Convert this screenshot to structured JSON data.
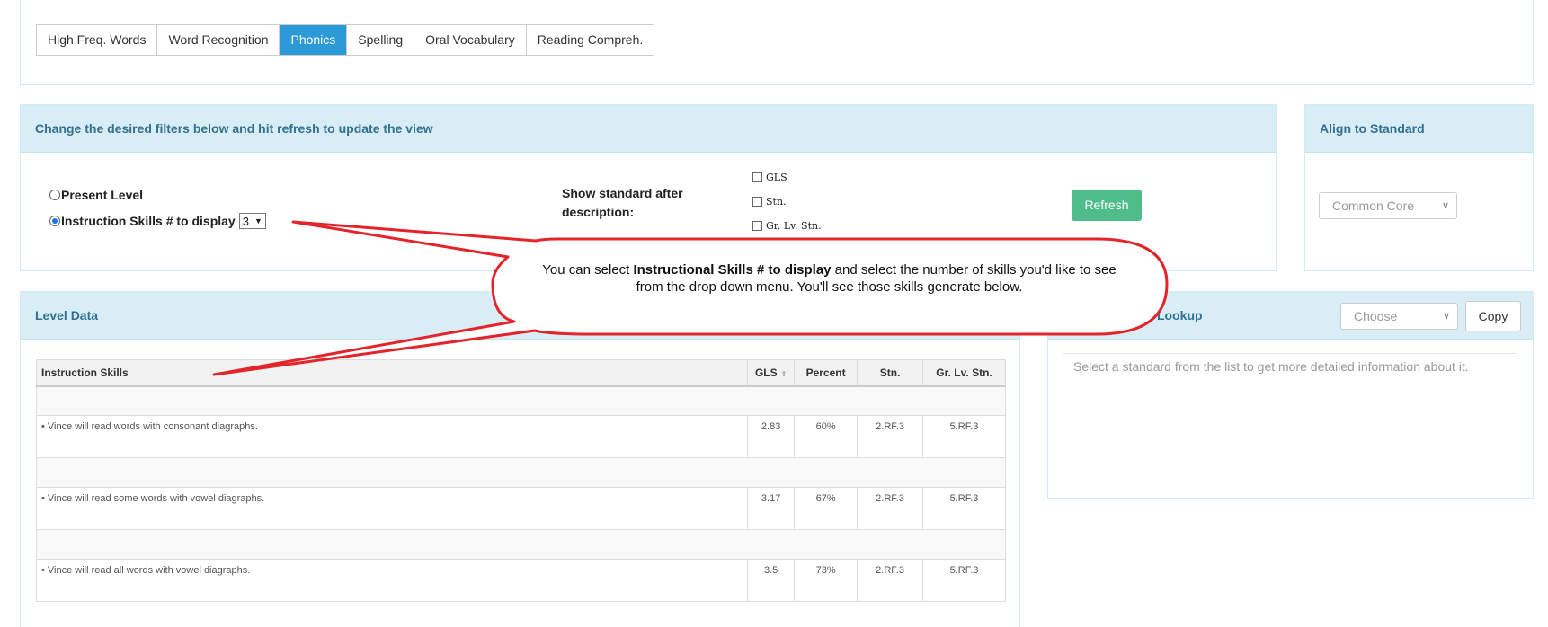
{
  "tabs": [
    {
      "label": "High Freq. Words",
      "active": false
    },
    {
      "label": "Word Recognition",
      "active": false
    },
    {
      "label": "Phonics",
      "active": true
    },
    {
      "label": "Spelling",
      "active": false
    },
    {
      "label": "Oral Vocabulary",
      "active": false
    },
    {
      "label": "Reading Compreh.",
      "active": false
    }
  ],
  "filters": {
    "heading": "Change the desired filters below and hit refresh to update the view",
    "present_level_label": "Present Level",
    "instruction_skills_label": "Instruction Skills # to display",
    "instruction_skills_value": "3",
    "show_standard_label": "Show standard after description:",
    "checkbox_gls": "GLS",
    "checkbox_stn": "Stn.",
    "checkbox_gr_lv_stn": "Gr. Lv. Stn.",
    "refresh_label": "Refresh"
  },
  "align": {
    "heading": "Align to Standard",
    "selected": "Common Core"
  },
  "level_data": {
    "heading": "Level Data",
    "columns": [
      "Instruction Skills",
      "GLS",
      "Percent",
      "Stn.",
      "Gr. Lv. Stn."
    ],
    "rows": [
      {
        "skill": "• Vince will read words with consonant diagraphs.",
        "gls": "2.83",
        "percent": "60%",
        "stn": "2.RF.3",
        "gr_lv_stn": "5.RF.3"
      },
      {
        "skill": "• Vince will read some words with vowel diagraphs.",
        "gls": "3.17",
        "percent": "67%",
        "stn": "2.RF.3",
        "gr_lv_stn": "5.RF.3"
      },
      {
        "skill": "• Vince will read all words with vowel diagraphs.",
        "gls": "3.5",
        "percent": "73%",
        "stn": "2.RF.3",
        "gr_lv_stn": "5.RF.3"
      }
    ]
  },
  "lookup": {
    "heading": "Lookup",
    "choose_placeholder": "Choose",
    "copy_label": "Copy",
    "help_text": "Select a standard from the list to get more detailed information about it."
  },
  "callout": {
    "text_before": "You can select ",
    "text_bold": "Instructional Skills # to display",
    "text_after": " and select the number of skills you'd like to see from the drop down menu. You'll see those skills generate below."
  },
  "colors": {
    "tab_active": "#2b9ad6",
    "panel_header_bg": "#d9edf7",
    "panel_header_text": "#31708f",
    "refresh_button": "#4ebc8b",
    "callout_stroke": "#e3242b"
  }
}
